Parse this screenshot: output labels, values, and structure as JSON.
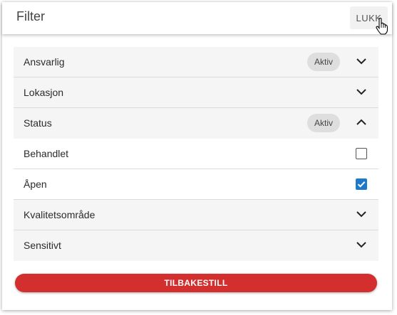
{
  "header": {
    "title": "Filter",
    "close_label": "LUKK"
  },
  "rows": [
    {
      "label": "Ansvarlig",
      "chip": "Aktiv",
      "expanded": false
    },
    {
      "label": "Lokasjon",
      "expanded": false
    },
    {
      "label": "Status",
      "chip": "Aktiv",
      "expanded": true
    },
    {
      "label": "Behandlet",
      "checked": false
    },
    {
      "label": "Åpen",
      "checked": true
    },
    {
      "label": "Kvalitetsområde",
      "expanded": false
    },
    {
      "label": "Sensitivt",
      "expanded": false
    }
  ],
  "reset_label": "TILBAKESTILL",
  "colors": {
    "accent_red": "#d32f2f",
    "checkbox_blue": "#1e7ac9"
  }
}
